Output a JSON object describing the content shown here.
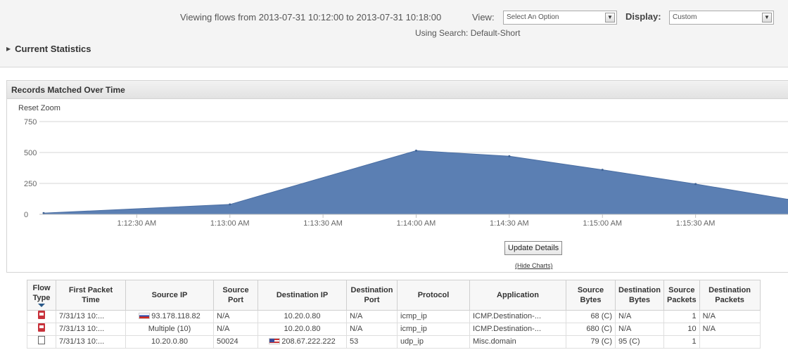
{
  "header": {
    "viewing_text": "Viewing flows from 2013-07-31 10:12:00 to 2013-07-31 10:18:00",
    "view_label": "View:",
    "view_select": "Select An Option",
    "display_label": "Display:",
    "display_select": "Custom",
    "using_search": "Using Search: Default-Short",
    "current_statistics": "Current Statistics"
  },
  "panel": {
    "title": "Records Matched Over Time",
    "reset_zoom": "Reset Zoom",
    "update_button": "Update Details",
    "hide_charts": "(Hide Charts)"
  },
  "chart_data": {
    "type": "area",
    "title": "",
    "xlabel": "",
    "ylabel": "",
    "ylim": [
      0,
      750
    ],
    "yticks": [
      0,
      250,
      500,
      750
    ],
    "xticks": [
      "1:12:30 AM",
      "1:13:00 AM",
      "1:13:30 AM",
      "1:14:00 AM",
      "1:14:30 AM",
      "1:15:00 AM",
      "1:15:30 AM"
    ],
    "x": [
      "1:12:00 AM",
      "1:13:00 AM",
      "1:14:00 AM",
      "1:14:30 AM",
      "1:15:00 AM",
      "1:15:30 AM",
      "1:16:00 AM"
    ],
    "series": [
      {
        "values": [
          10,
          80,
          515,
          470,
          360,
          245,
          120
        ]
      }
    ],
    "color": "#5b7fb3",
    "grid": true
  },
  "table": {
    "headers": [
      "Flow Type",
      "First Packet Time",
      "Source IP",
      "Source Port",
      "Destination IP",
      "Destination Port",
      "Protocol",
      "Application",
      "Source Bytes",
      "Destination Bytes",
      "Source Packets",
      "Destination Packets"
    ],
    "rows": [
      {
        "icon": "red-flow-icon",
        "time": "7/31/13 10:...",
        "src_ip": "93.178.118.82",
        "src_flag": "russia-flag-icon",
        "src_port": "N/A",
        "dst_ip": "10.20.0.80",
        "dst_flag": "",
        "dst_port": "N/A",
        "protocol": "icmp_ip",
        "application": "ICMP.Destination-...",
        "src_bytes": "68 (C)",
        "dst_bytes": "N/A",
        "src_packets": "1",
        "dst_packets": "N/A"
      },
      {
        "icon": "red-flow-icon",
        "time": "7/31/13 10:...",
        "src_ip": "Multiple (10)",
        "src_flag": "",
        "src_port": "N/A",
        "dst_ip": "10.20.0.80",
        "dst_flag": "",
        "dst_port": "N/A",
        "protocol": "icmp_ip",
        "application": "ICMP.Destination-...",
        "src_bytes": "680 (C)",
        "dst_bytes": "N/A",
        "src_packets": "10",
        "dst_packets": "N/A"
      },
      {
        "icon": "blank-flow-icon",
        "time": "7/31/13 10:...",
        "src_ip": "10.20.0.80",
        "src_flag": "",
        "src_port": "50024",
        "dst_ip": "208.67.222.222",
        "dst_flag": "us-flag-icon",
        "dst_port": "53",
        "protocol": "udp_ip",
        "application": "Misc.domain",
        "src_bytes": "79 (C)",
        "dst_bytes": "95 (C)",
        "src_packets": "1",
        "dst_packets": ""
      }
    ]
  }
}
